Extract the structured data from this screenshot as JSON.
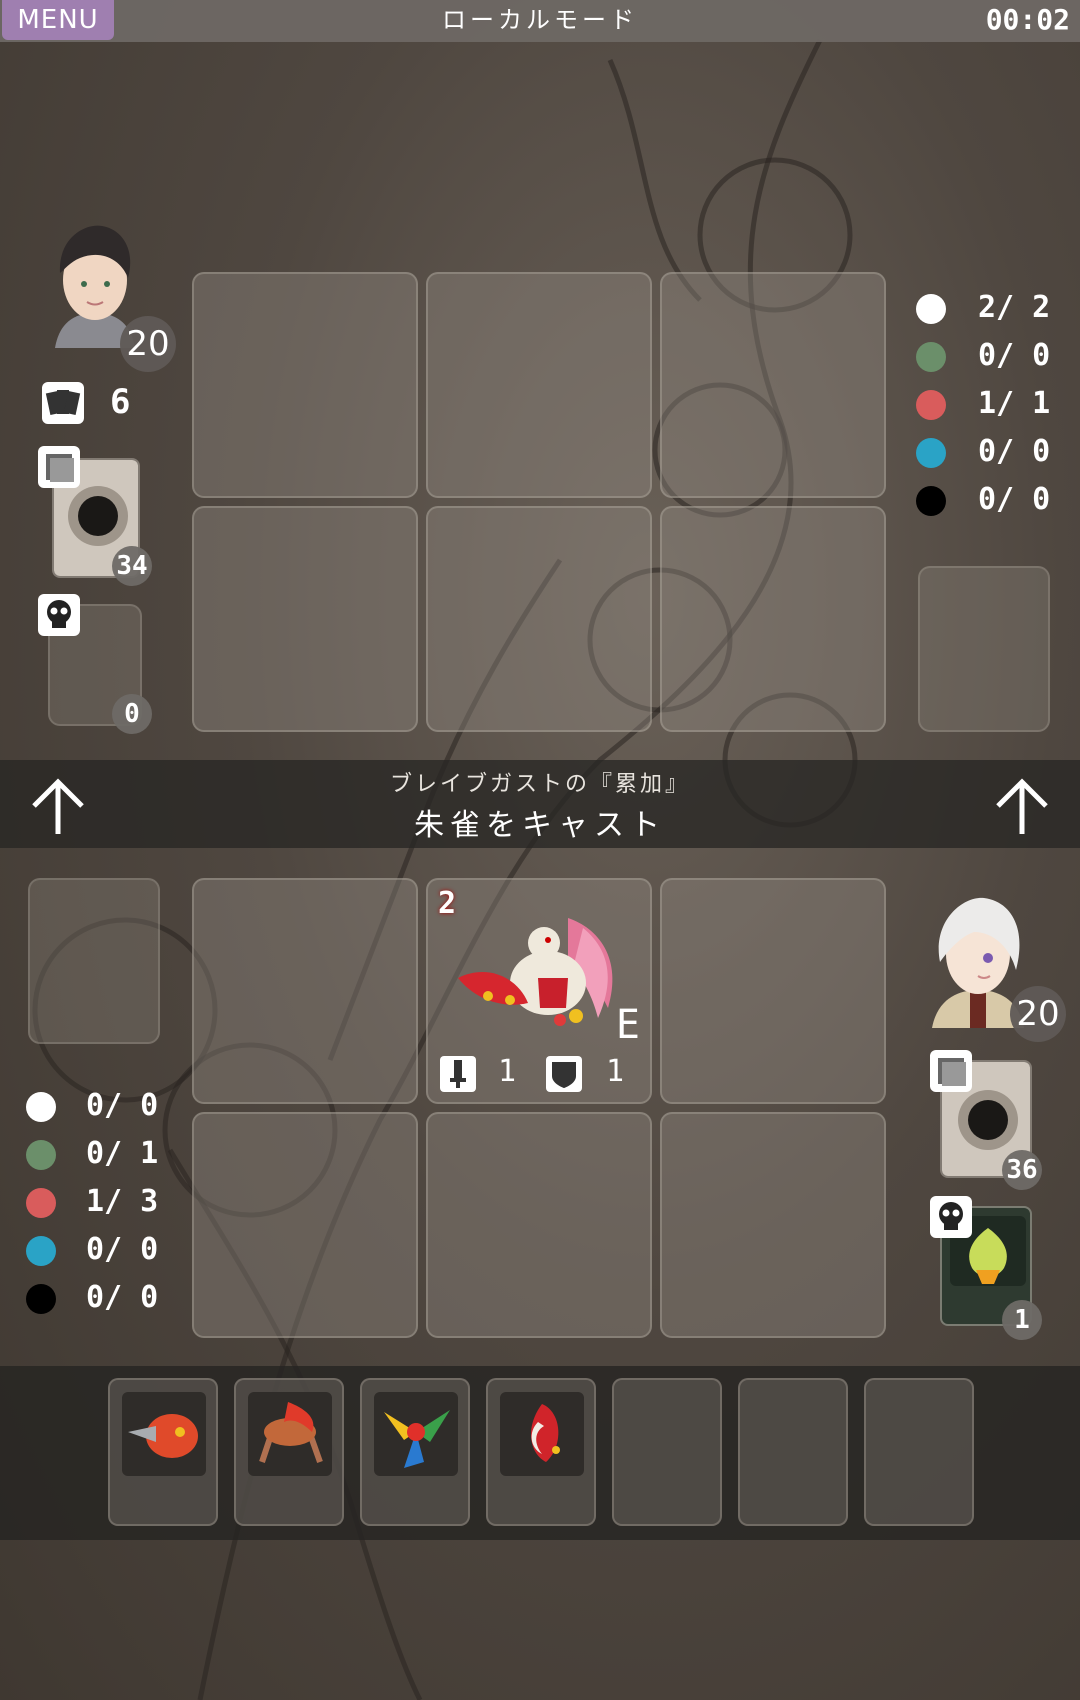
{
  "topbar": {
    "menu_label": "MENU",
    "title": "ローカルモード",
    "time": "00:02"
  },
  "opponent": {
    "life": "20",
    "hand_count": "6",
    "deck_count": "34",
    "grave_count": "0",
    "mana": [
      {
        "color": "#ffffff",
        "text": "2/ 2"
      },
      {
        "color": "#6b8f6a",
        "text": "0/ 0"
      },
      {
        "color": "#d95c5c",
        "text": "1/ 1"
      },
      {
        "color": "#2aa3c6",
        "text": "0/ 0"
      },
      {
        "color": "#000000",
        "text": "0/ 0"
      }
    ]
  },
  "message": {
    "line1": "ブレイブガストの『累加』",
    "line2": "朱雀をキャスト"
  },
  "player": {
    "life": "20",
    "deck_count": "36",
    "grave_count": "1",
    "mana": [
      {
        "color": "#ffffff",
        "text": "0/ 0"
      },
      {
        "color": "#6b8f6a",
        "text": "0/ 1"
      },
      {
        "color": "#d95c5c",
        "text": "1/ 3"
      },
      {
        "color": "#2aa3c6",
        "text": "0/ 0"
      },
      {
        "color": "#000000",
        "text": "0/ 0"
      }
    ]
  },
  "field_card": {
    "cost": "2",
    "type_letter": "E",
    "attack": "1",
    "defense": "1"
  },
  "hand": {
    "filled": 4,
    "total": 7
  }
}
